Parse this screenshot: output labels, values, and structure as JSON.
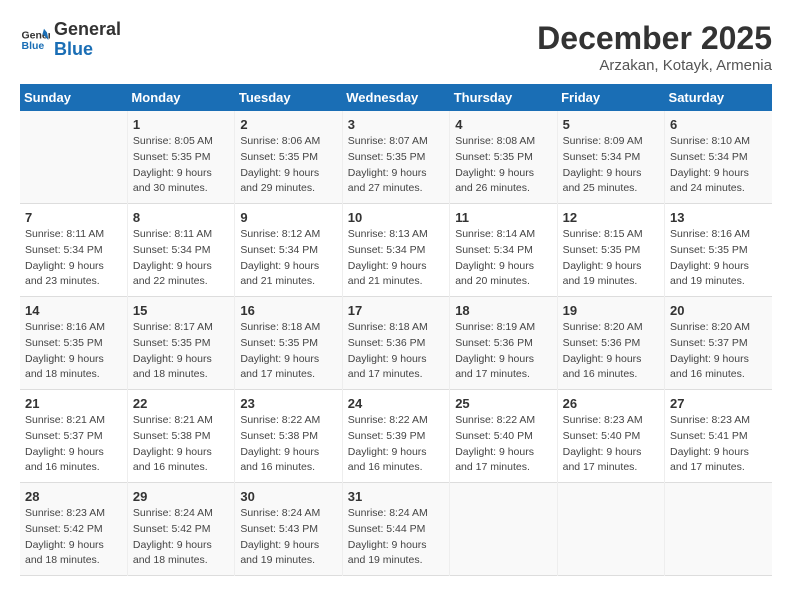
{
  "header": {
    "logo_line1": "General",
    "logo_line2": "Blue",
    "month": "December 2025",
    "location": "Arzakan, Kotayk, Armenia"
  },
  "days_of_week": [
    "Sunday",
    "Monday",
    "Tuesday",
    "Wednesday",
    "Thursday",
    "Friday",
    "Saturday"
  ],
  "weeks": [
    [
      {
        "day": "",
        "info": ""
      },
      {
        "day": "1",
        "info": "Sunrise: 8:05 AM\nSunset: 5:35 PM\nDaylight: 9 hours\nand 30 minutes."
      },
      {
        "day": "2",
        "info": "Sunrise: 8:06 AM\nSunset: 5:35 PM\nDaylight: 9 hours\nand 29 minutes."
      },
      {
        "day": "3",
        "info": "Sunrise: 8:07 AM\nSunset: 5:35 PM\nDaylight: 9 hours\nand 27 minutes."
      },
      {
        "day": "4",
        "info": "Sunrise: 8:08 AM\nSunset: 5:35 PM\nDaylight: 9 hours\nand 26 minutes."
      },
      {
        "day": "5",
        "info": "Sunrise: 8:09 AM\nSunset: 5:34 PM\nDaylight: 9 hours\nand 25 minutes."
      },
      {
        "day": "6",
        "info": "Sunrise: 8:10 AM\nSunset: 5:34 PM\nDaylight: 9 hours\nand 24 minutes."
      }
    ],
    [
      {
        "day": "7",
        "info": "Sunrise: 8:11 AM\nSunset: 5:34 PM\nDaylight: 9 hours\nand 23 minutes."
      },
      {
        "day": "8",
        "info": "Sunrise: 8:11 AM\nSunset: 5:34 PM\nDaylight: 9 hours\nand 22 minutes."
      },
      {
        "day": "9",
        "info": "Sunrise: 8:12 AM\nSunset: 5:34 PM\nDaylight: 9 hours\nand 21 minutes."
      },
      {
        "day": "10",
        "info": "Sunrise: 8:13 AM\nSunset: 5:34 PM\nDaylight: 9 hours\nand 21 minutes."
      },
      {
        "day": "11",
        "info": "Sunrise: 8:14 AM\nSunset: 5:34 PM\nDaylight: 9 hours\nand 20 minutes."
      },
      {
        "day": "12",
        "info": "Sunrise: 8:15 AM\nSunset: 5:35 PM\nDaylight: 9 hours\nand 19 minutes."
      },
      {
        "day": "13",
        "info": "Sunrise: 8:16 AM\nSunset: 5:35 PM\nDaylight: 9 hours\nand 19 minutes."
      }
    ],
    [
      {
        "day": "14",
        "info": "Sunrise: 8:16 AM\nSunset: 5:35 PM\nDaylight: 9 hours\nand 18 minutes."
      },
      {
        "day": "15",
        "info": "Sunrise: 8:17 AM\nSunset: 5:35 PM\nDaylight: 9 hours\nand 18 minutes."
      },
      {
        "day": "16",
        "info": "Sunrise: 8:18 AM\nSunset: 5:35 PM\nDaylight: 9 hours\nand 17 minutes."
      },
      {
        "day": "17",
        "info": "Sunrise: 8:18 AM\nSunset: 5:36 PM\nDaylight: 9 hours\nand 17 minutes."
      },
      {
        "day": "18",
        "info": "Sunrise: 8:19 AM\nSunset: 5:36 PM\nDaylight: 9 hours\nand 17 minutes."
      },
      {
        "day": "19",
        "info": "Sunrise: 8:20 AM\nSunset: 5:36 PM\nDaylight: 9 hours\nand 16 minutes."
      },
      {
        "day": "20",
        "info": "Sunrise: 8:20 AM\nSunset: 5:37 PM\nDaylight: 9 hours\nand 16 minutes."
      }
    ],
    [
      {
        "day": "21",
        "info": "Sunrise: 8:21 AM\nSunset: 5:37 PM\nDaylight: 9 hours\nand 16 minutes."
      },
      {
        "day": "22",
        "info": "Sunrise: 8:21 AM\nSunset: 5:38 PM\nDaylight: 9 hours\nand 16 minutes."
      },
      {
        "day": "23",
        "info": "Sunrise: 8:22 AM\nSunset: 5:38 PM\nDaylight: 9 hours\nand 16 minutes."
      },
      {
        "day": "24",
        "info": "Sunrise: 8:22 AM\nSunset: 5:39 PM\nDaylight: 9 hours\nand 16 minutes."
      },
      {
        "day": "25",
        "info": "Sunrise: 8:22 AM\nSunset: 5:40 PM\nDaylight: 9 hours\nand 17 minutes."
      },
      {
        "day": "26",
        "info": "Sunrise: 8:23 AM\nSunset: 5:40 PM\nDaylight: 9 hours\nand 17 minutes."
      },
      {
        "day": "27",
        "info": "Sunrise: 8:23 AM\nSunset: 5:41 PM\nDaylight: 9 hours\nand 17 minutes."
      }
    ],
    [
      {
        "day": "28",
        "info": "Sunrise: 8:23 AM\nSunset: 5:42 PM\nDaylight: 9 hours\nand 18 minutes."
      },
      {
        "day": "29",
        "info": "Sunrise: 8:24 AM\nSunset: 5:42 PM\nDaylight: 9 hours\nand 18 minutes."
      },
      {
        "day": "30",
        "info": "Sunrise: 8:24 AM\nSunset: 5:43 PM\nDaylight: 9 hours\nand 19 minutes."
      },
      {
        "day": "31",
        "info": "Sunrise: 8:24 AM\nSunset: 5:44 PM\nDaylight: 9 hours\nand 19 minutes."
      },
      {
        "day": "",
        "info": ""
      },
      {
        "day": "",
        "info": ""
      },
      {
        "day": "",
        "info": ""
      }
    ]
  ]
}
